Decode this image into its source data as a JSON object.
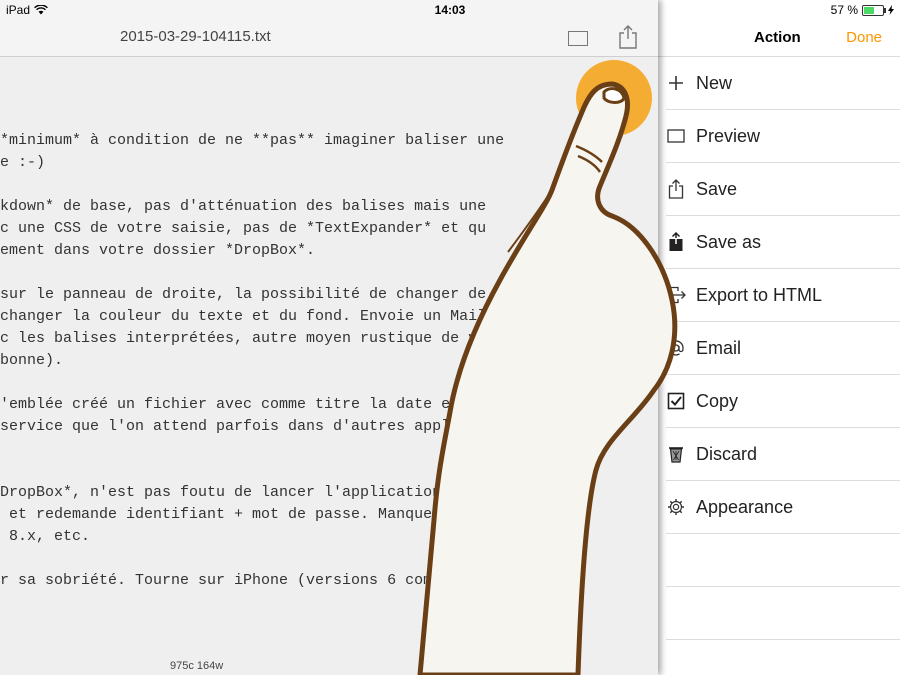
{
  "status_bar": {
    "carrier": "iPad",
    "time": "14:03",
    "battery_text": "57 %",
    "battery_level": 0.57,
    "icons": [
      "wifi-icon",
      "battery-icon",
      "charging-icon"
    ]
  },
  "editor": {
    "title": "2015-03-29-104115.txt",
    "toolbar_icons": [
      "preview-icon",
      "share-icon"
    ],
    "lines": [
      "*minimum* à condition de ne **pas** imaginer baliser une",
      "e :-)",
      "",
      "kdown* de base, pas d'atténuation des balises mais une",
      "c une CSS de votre saisie, pas de *TextExpander* et qu",
      "ement dans votre dossier *DropBox*.",
      "",
      "sur le panneau de droite, la possibilité de changer de type",
      "changer la couleur du texte et du fond. Envoie un Mail texte",
      "c les balises interprétées, autre moyen rustique de voir si",
      "bonne).",
      "",
      "'emblée créé un fichier avec comme titre la date et l'heure.",
      "service que l'on attend parfois dans d'autres applications",
      "",
      "",
      "DropBox*, n'est pas foutu de lancer l'application idoine",
      " et redemande identifiant + mot de passe. Manque les options",
      " 8.x, etc.",
      "",
      "r sa sobriété. Tourne sur iPhone (versions 6 comprises)"
    ],
    "counts": "975c  164w"
  },
  "panel": {
    "title": "Action",
    "done_label": "Done",
    "accent_color": "#ff9500",
    "items": [
      {
        "label": "New",
        "icon": "plus-icon"
      },
      {
        "label": "Preview",
        "icon": "preview-icon"
      },
      {
        "label": "Save",
        "icon": "share-icon"
      },
      {
        "label": "Save as",
        "icon": "save-as-icon"
      },
      {
        "label": "Export to HTML",
        "icon": "export-icon"
      },
      {
        "label": "Email",
        "icon": "at-icon"
      },
      {
        "label": "Copy",
        "icon": "checkbox-icon"
      },
      {
        "label": "Discard",
        "icon": "trash-icon"
      },
      {
        "label": "Appearance",
        "icon": "gear-icon"
      }
    ]
  },
  "touch_indicator": {
    "color": "#f5a623",
    "icon": "finger-icon"
  }
}
